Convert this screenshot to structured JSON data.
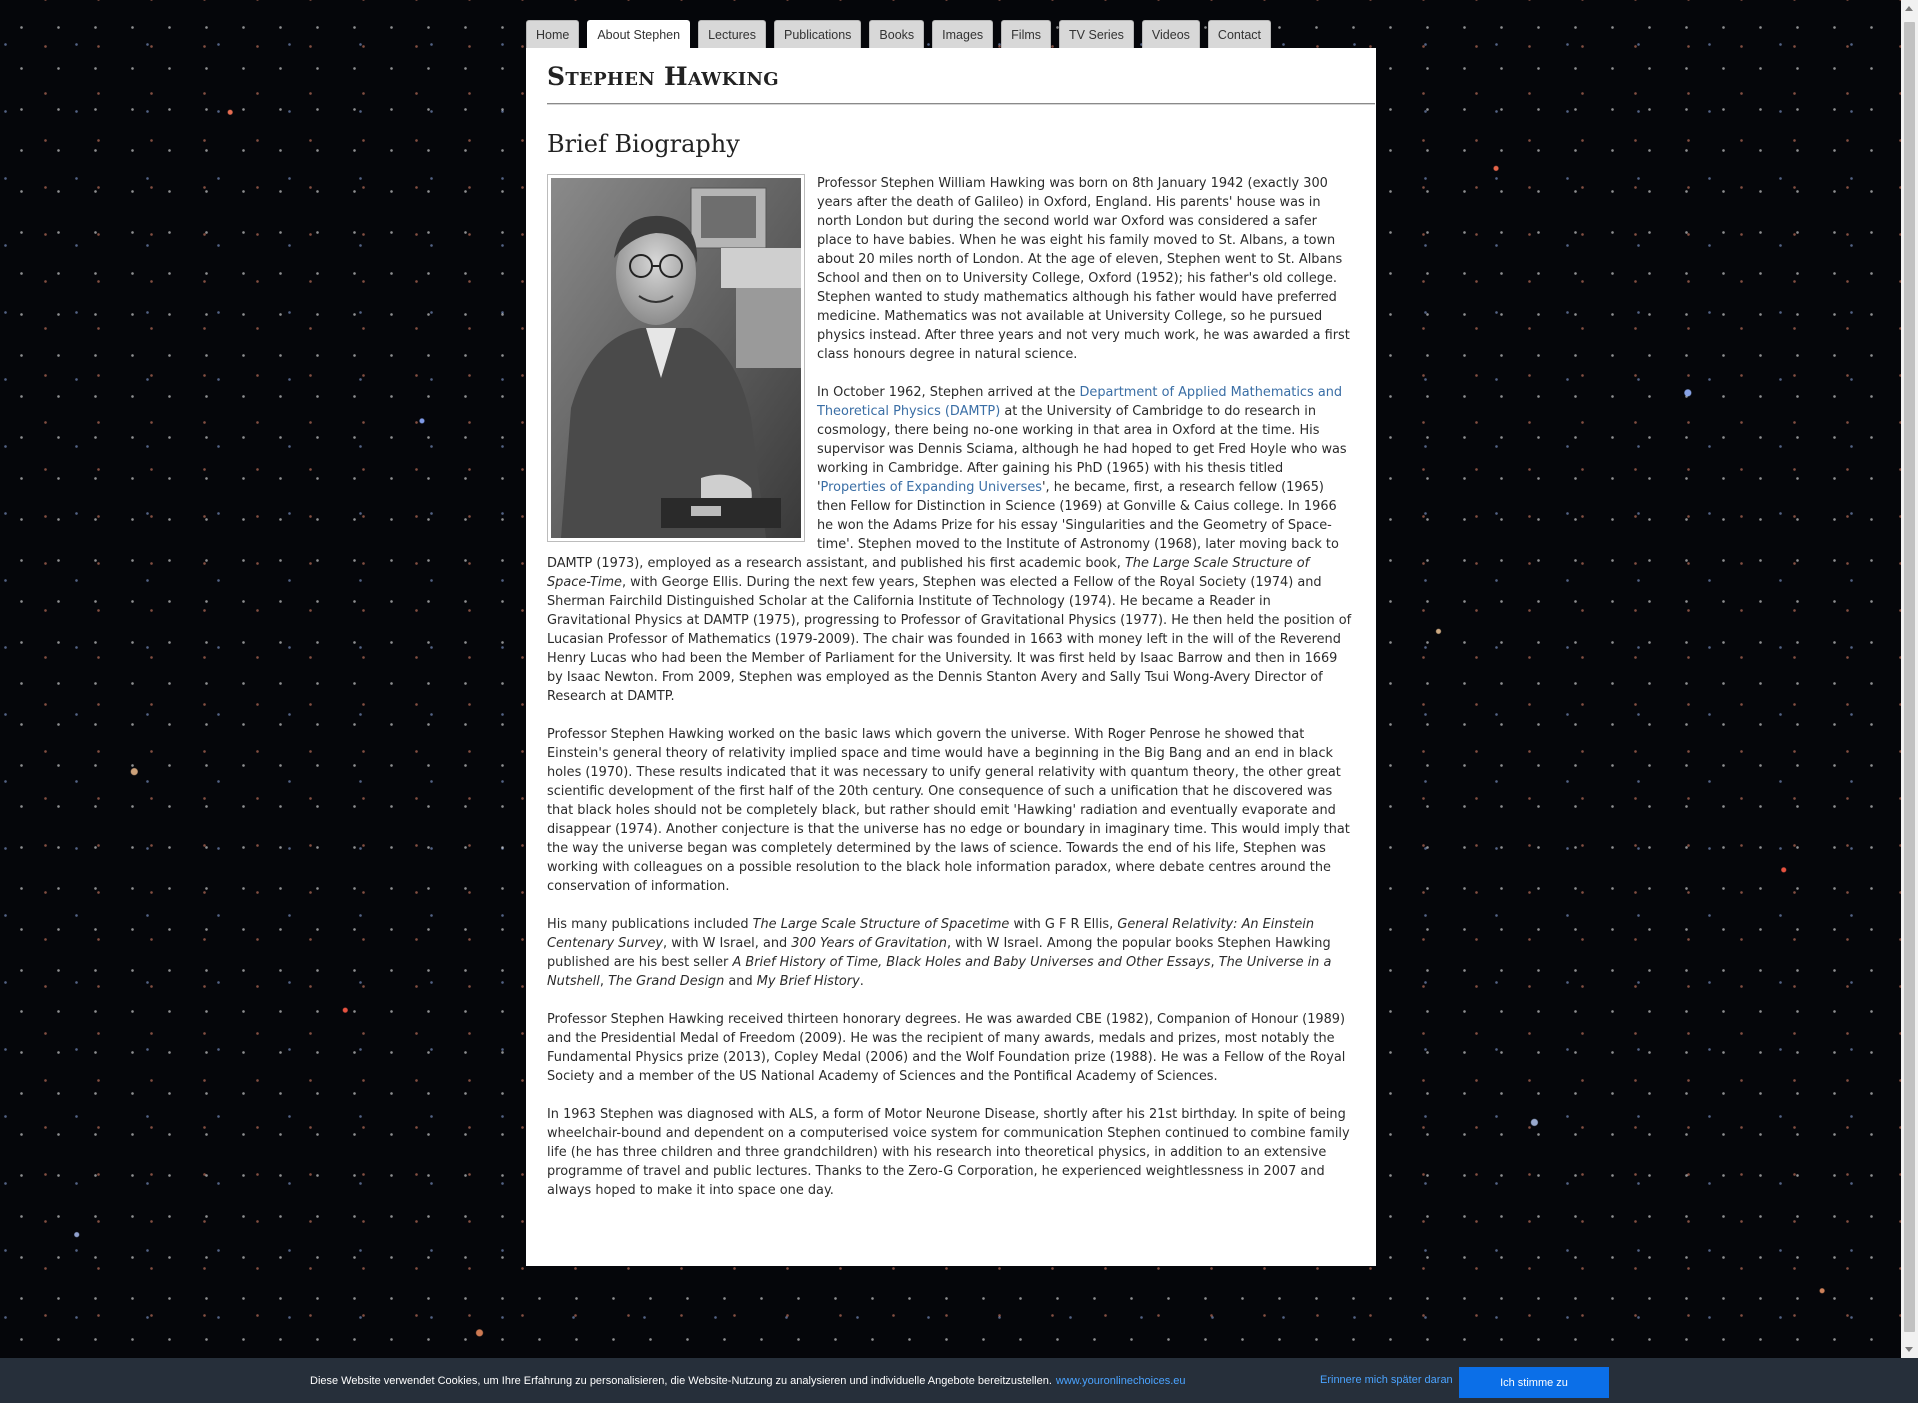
{
  "nav": {
    "tabs": [
      {
        "label": "Home"
      },
      {
        "label": "About Stephen"
      },
      {
        "label": "Lectures"
      },
      {
        "label": "Publications"
      },
      {
        "label": "Books"
      },
      {
        "label": "Images"
      },
      {
        "label": "Films"
      },
      {
        "label": "TV Series"
      },
      {
        "label": "Videos"
      },
      {
        "label": "Contact"
      }
    ],
    "active": "About Stephen"
  },
  "site_title": "Stephen Hawking",
  "section_title": "Brief Biography",
  "bio": {
    "p1": "Professor Stephen William Hawking was born on 8th January 1942 (exactly 300 years after the death of Galileo) in Oxford, England. His parents' house was in north London but during the second world war Oxford was considered a safer place to have babies. When he was eight his family moved to St. Albans, a town about 20 miles north of London. At the age of eleven, Stephen went to St. Albans School and then on to University College, Oxford (1952); his father's old college. Stephen wanted to study mathematics although his father would have preferred medicine. Mathematics was not available at University College, so he pursued physics instead. After three years and not very much work, he was awarded a first class honours degree in natural science.",
    "p2_a": "In October 1962, Stephen arrived at the ",
    "p2_link1": "Department of Applied Mathematics and Theoretical Physics (DAMTP)",
    "p2_b": " at the University of Cambridge to do research in cosmology, there being no-one working in that area in Oxford at the time. His supervisor was Dennis Sciama, although he had hoped to get Fred Hoyle who was working in Cambridge. After gaining his PhD (1965) with his thesis titled '",
    "p2_link2": "Properties of Expanding Universes",
    "p2_c": "', he became, first, a research fellow (1965) then Fellow for Distinction in Science (1969) at Gonville & Caius college. In 1966 he won the Adams Prize for his essay 'Singularities and the Geometry of Space-time'. Stephen moved to the Institute of Astronomy (1968), later moving back to DAMTP (1973), employed as a research assistant, and published his first academic book, ",
    "p2_book": "The Large Scale Structure of Space-Time",
    "p2_d": ", with George Ellis. During the next few years, Stephen was elected a Fellow of the Royal Society (1974) and Sherman Fairchild Distinguished Scholar at the California Institute of Technology (1974). He became a Reader in Gravitational Physics at DAMTP (1975), progressing to Professor of Gravitational Physics (1977). He then held the position of Lucasian Professor of Mathematics (1979-2009). The chair was founded in 1663 with money left in the will of the Reverend Henry Lucas who had been the Member of Parliament for the University. It was first held by Isaac Barrow and then in 1669 by Isaac Newton.  From 2009, Stephen was employed as the Dennis Stanton Avery and Sally Tsui Wong-Avery Director of Research at DAMTP.",
    "p3": "Professor Stephen Hawking worked on the basic laws which govern the universe. With Roger Penrose he showed that Einstein's general theory of relativity implied space and time would have a beginning in the Big Bang and an end in black holes (1970). These results indicated that it was necessary to unify general relativity with quantum theory, the other great scientific development of the first half of the 20th century. One consequence of such a unification that he discovered was that black holes should not be completely black, but rather should emit 'Hawking' radiation and eventually evaporate and disappear (1974). Another conjecture is that the universe has no edge or boundary in imaginary time. This would imply that the way the universe began was completely determined by the laws of science. Towards the end of his life, Stephen was working with colleagues on a possible resolution to the black hole information paradox, where debate centres around the conservation of information.",
    "p4_a": "His many publications included ",
    "p4_i1": "The Large Scale Structure of Spacetime",
    "p4_b": " with G F R Ellis, ",
    "p4_i2": "General Relativity: An Einstein Centenary Survey",
    "p4_c": ", with W Israel, and ",
    "p4_i3": "300 Years of Gravitation",
    "p4_d": ", with W Israel. Among the popular books Stephen Hawking published are his best seller ",
    "p4_i4": "A Brief History of Time, Black Holes and Baby Universes and Other Essays",
    "p4_e": ", ",
    "p4_i5": "The Universe in a Nutshell",
    "p4_f": ", ",
    "p4_i6": "The Grand Design",
    "p4_g": " and ",
    "p4_i7": "My Brief History",
    "p4_h": ".",
    "p5": "Professor Stephen Hawking received thirteen honorary degrees. He was awarded CBE (1982), Companion of Honour (1989) and the Presidential Medal of Freedom (2009). He was the recipient of many awards, medals and prizes, most notably the Fundamental Physics prize (2013), Copley Medal (2006) and the Wolf Foundation prize (1988). He was a Fellow of the Royal Society and a member of the US National Academy of Sciences and the Pontifical Academy of Sciences.",
    "p6": "In 1963 Stephen was diagnosed with ALS, a form of Motor Neurone Disease, shortly after his 21st birthday. In spite of being wheelchair-bound and dependent on a computerised voice system for communication Stephen continued to combine family life (he has three children and three grandchildren) with his research into theoretical physics, in addition to an extensive programme of travel and public lectures. Thanks to the Zero-G Corporation, he experienced weightlessness in 2007 and always hoped to make it into space one day."
  },
  "cookie": {
    "text": "Diese Website verwendet Cookies, um Ihre Erfahrung zu personalisieren, die Website-Nutzung zu analysieren und individuelle Angebote bereitzustellen.",
    "link": "www.youronlinechoices.eu",
    "remind_label": "Erinnere mich später daran",
    "agree_label": "Ich stimme zu"
  },
  "colors": {
    "link": "#3a6ea5",
    "cookie_bar": "#262f3a",
    "agree_button": "#0b6fe8"
  }
}
